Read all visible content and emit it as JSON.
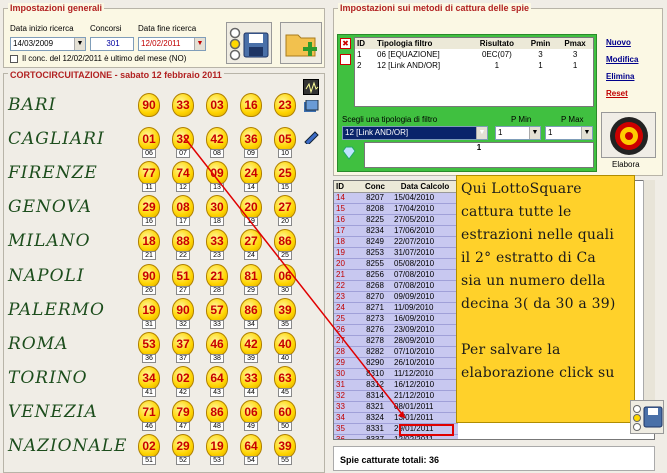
{
  "general": {
    "title": "Impostazioni generali",
    "start_label": "Data inizio ricerca",
    "start_value": "14/03/2009",
    "draws_label": "Concorsi",
    "draws_value": "301",
    "end_label": "Data fine ricerca",
    "end_value": "12/02/2011",
    "checkbox_label": "Il conc. del 12/02/2011 è ultimo del mese (NO)"
  },
  "short_circuit_title": "CORTOCIRCUITAZIONE - sabato 12 febbraio 2011",
  "wheels": [
    {
      "name": "BARI",
      "numbers": [
        "90",
        "33",
        "03",
        "16",
        "23"
      ],
      "tags": [
        "",
        "",
        "",
        "",
        ""
      ]
    },
    {
      "name": "CAGLIARI",
      "numbers": [
        "01",
        "32",
        "42",
        "36",
        "05"
      ],
      "tags": [
        "06",
        "07",
        "08",
        "09",
        "10"
      ]
    },
    {
      "name": "FIRENZE",
      "numbers": [
        "77",
        "74",
        "09",
        "24",
        "25"
      ],
      "tags": [
        "11",
        "12",
        "13",
        "14",
        "15"
      ]
    },
    {
      "name": "GENOVA",
      "numbers": [
        "29",
        "08",
        "30",
        "20",
        "27"
      ],
      "tags": [
        "16",
        "17",
        "18",
        "19",
        "20"
      ]
    },
    {
      "name": "MILANO",
      "numbers": [
        "18",
        "88",
        "33",
        "27",
        "86"
      ],
      "tags": [
        "21",
        "22",
        "23",
        "24",
        "25"
      ]
    },
    {
      "name": "NAPOLI",
      "numbers": [
        "90",
        "51",
        "21",
        "81",
        "06"
      ],
      "tags": [
        "26",
        "27",
        "28",
        "29",
        "30"
      ]
    },
    {
      "name": "PALERMO",
      "numbers": [
        "19",
        "90",
        "57",
        "86",
        "39"
      ],
      "tags": [
        "31",
        "32",
        "33",
        "34",
        "35"
      ]
    },
    {
      "name": "ROMA",
      "numbers": [
        "53",
        "37",
        "46",
        "42",
        "40"
      ],
      "tags": [
        "36",
        "37",
        "38",
        "39",
        "40"
      ]
    },
    {
      "name": "TORINO",
      "numbers": [
        "34",
        "02",
        "64",
        "33",
        "63"
      ],
      "tags": [
        "41",
        "42",
        "43",
        "44",
        "45"
      ]
    },
    {
      "name": "VENEZIA",
      "numbers": [
        "71",
        "79",
        "86",
        "06",
        "60"
      ],
      "tags": [
        "46",
        "47",
        "48",
        "49",
        "50"
      ]
    },
    {
      "name": "NAZIONALE",
      "numbers": [
        "02",
        "29",
        "19",
        "64",
        "39"
      ],
      "tags": [
        "51",
        "52",
        "53",
        "54",
        "55"
      ]
    }
  ],
  "spie": {
    "title": "Impostazioni sui metodi di cattura delle spie",
    "headers": [
      "ID",
      "Tipologia filtro",
      "Risultato",
      "Pmin",
      "Pmax"
    ],
    "rows": [
      {
        "id": "1",
        "tipo": "06 [EQUAZIONE]",
        "ris": "0EC(07)",
        "pmin": "3",
        "pmax": "3"
      },
      {
        "id": "2",
        "tipo": "12 [Link AND/OR]",
        "ris": "1",
        "pmin": "1",
        "pmax": "1"
      }
    ],
    "links": [
      "Nuovo",
      "Modifica",
      "Elimina",
      "Reset"
    ],
    "filter_label": "Scegli una tipologia di filtro",
    "filter_value": "12 [Link AND/OR]",
    "pmin_label": "P Min",
    "pmin_value": "1",
    "pmax_label": "P Max",
    "pmax_value": "1",
    "result_value": "1",
    "elabora_label": "Elabora"
  },
  "results": {
    "headers": [
      "ID",
      "Conc",
      "Data Calcolo"
    ],
    "rows": [
      [
        "14",
        "8207",
        "15/04/2010"
      ],
      [
        "15",
        "8208",
        "17/04/2010"
      ],
      [
        "16",
        "8225",
        "27/05/2010"
      ],
      [
        "17",
        "8234",
        "17/06/2010"
      ],
      [
        "18",
        "8249",
        "22/07/2010"
      ],
      [
        "19",
        "8253",
        "31/07/2010"
      ],
      [
        "20",
        "8255",
        "05/08/2010"
      ],
      [
        "21",
        "8256",
        "07/08/2010"
      ],
      [
        "22",
        "8268",
        "07/08/2010"
      ],
      [
        "23",
        "8270",
        "09/09/2010"
      ],
      [
        "24",
        "8271",
        "11/09/2010"
      ],
      [
        "25",
        "8273",
        "16/09/2010"
      ],
      [
        "26",
        "8276",
        "23/09/2010"
      ],
      [
        "27",
        "8278",
        "28/09/2010"
      ],
      [
        "28",
        "8282",
        "07/10/2010"
      ],
      [
        "29",
        "8290",
        "26/10/2010"
      ],
      [
        "30",
        "8310",
        "11/12/2010"
      ],
      [
        "31",
        "8312",
        "16/12/2010"
      ],
      [
        "32",
        "8314",
        "21/12/2010"
      ],
      [
        "33",
        "8321",
        "08/01/2011"
      ],
      [
        "34",
        "8324",
        "13/01/2011"
      ],
      [
        "35",
        "8331",
        "29/01/2011"
      ],
      [
        "36",
        "8337",
        "12/02/2011"
      ]
    ],
    "footer": "Spie catturate totali: 36"
  },
  "note": {
    "lines": [
      "Qui LottoSquare",
      "cattura tutte le",
      "estrazioni nelle quali",
      "il 2° estratto di Ca",
      "sia un numero della",
      "decina 3( da 30 a 39)",
      "",
      "Per salvare la",
      "elaborazione click su"
    ]
  },
  "colors": {
    "accent_red": "#c00000",
    "ball_yellow": "#ffd400",
    "note_yellow": "#ffd12a",
    "row_lilac": "#c8c8f0"
  }
}
